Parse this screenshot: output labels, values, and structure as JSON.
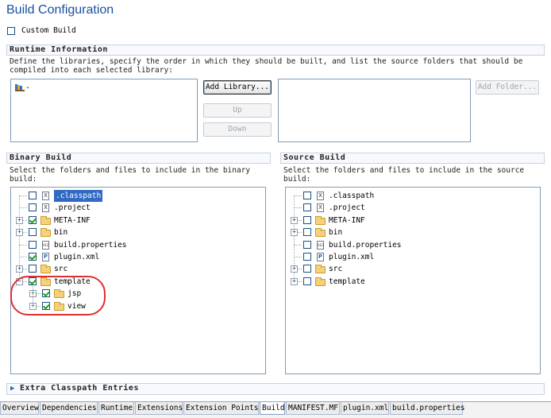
{
  "title": "Build Configuration",
  "custom_build": {
    "label": "Custom Build",
    "checked": false
  },
  "runtime": {
    "heading": "Runtime Information",
    "description": "Define the libraries, specify the order in which they should be built, and list the source folders that should be compiled into each selected library:",
    "library_item": ".",
    "buttons": {
      "add_library": "Add Library...",
      "up": "Up",
      "down": "Down",
      "add_folder": "Add Folder..."
    }
  },
  "binary": {
    "heading": "Binary Build",
    "description": "Select the folders and files to include in the binary build:",
    "items": [
      {
        "label": ".classpath",
        "type": "file",
        "file_glyph": "X",
        "checked": false,
        "selected": true
      },
      {
        "label": ".project",
        "type": "file",
        "file_glyph": "X",
        "checked": false
      },
      {
        "label": "META-INF",
        "type": "folder",
        "checked": true,
        "expandable": true
      },
      {
        "label": "bin",
        "type": "folder",
        "checked": false,
        "expandable": true
      },
      {
        "label": "build.properties",
        "type": "file",
        "file_glyph": "010",
        "checked": false
      },
      {
        "label": "plugin.xml",
        "type": "file",
        "file_glyph": "P",
        "checked": true
      },
      {
        "label": "src",
        "type": "folder",
        "checked": false,
        "expandable": true
      },
      {
        "label": "template",
        "type": "folder",
        "checked": true,
        "expandable": true,
        "expanded": true
      },
      {
        "label": "jsp",
        "type": "folder",
        "checked": true,
        "expandable": true,
        "child": true
      },
      {
        "label": "view",
        "type": "folder",
        "checked": true,
        "expandable": true,
        "child": true
      }
    ]
  },
  "source": {
    "heading": "Source Build",
    "description": "Select the folders and files to include in the source build:",
    "items": [
      {
        "label": ".classpath",
        "type": "file",
        "file_glyph": "X",
        "checked": false
      },
      {
        "label": ".project",
        "type": "file",
        "file_glyph": "X",
        "checked": false
      },
      {
        "label": "META-INF",
        "type": "folder",
        "checked": false,
        "expandable": true
      },
      {
        "label": "bin",
        "type": "folder",
        "checked": false,
        "expandable": true
      },
      {
        "label": "build.properties",
        "type": "file",
        "file_glyph": "010",
        "checked": false
      },
      {
        "label": "plugin.xml",
        "type": "file",
        "file_glyph": "P",
        "checked": false
      },
      {
        "label": "src",
        "type": "folder",
        "checked": false,
        "expandable": true
      },
      {
        "label": "template",
        "type": "folder",
        "checked": false,
        "expandable": true
      }
    ]
  },
  "extra_classpath": {
    "heading": "Extra Classpath Entries"
  },
  "tabs": [
    {
      "label": "Overview"
    },
    {
      "label": "Dependencies"
    },
    {
      "label": "Runtime"
    },
    {
      "label": "Extensions"
    },
    {
      "label": "Extension Points"
    },
    {
      "label": "Build",
      "active": true
    },
    {
      "label": "MANIFEST.MF"
    },
    {
      "label": "plugin.xml"
    },
    {
      "label": "build.properties"
    }
  ],
  "colors": {
    "title": "#1a4fa3",
    "highlight_outline": "#e03030",
    "selection": "#316ac5"
  }
}
